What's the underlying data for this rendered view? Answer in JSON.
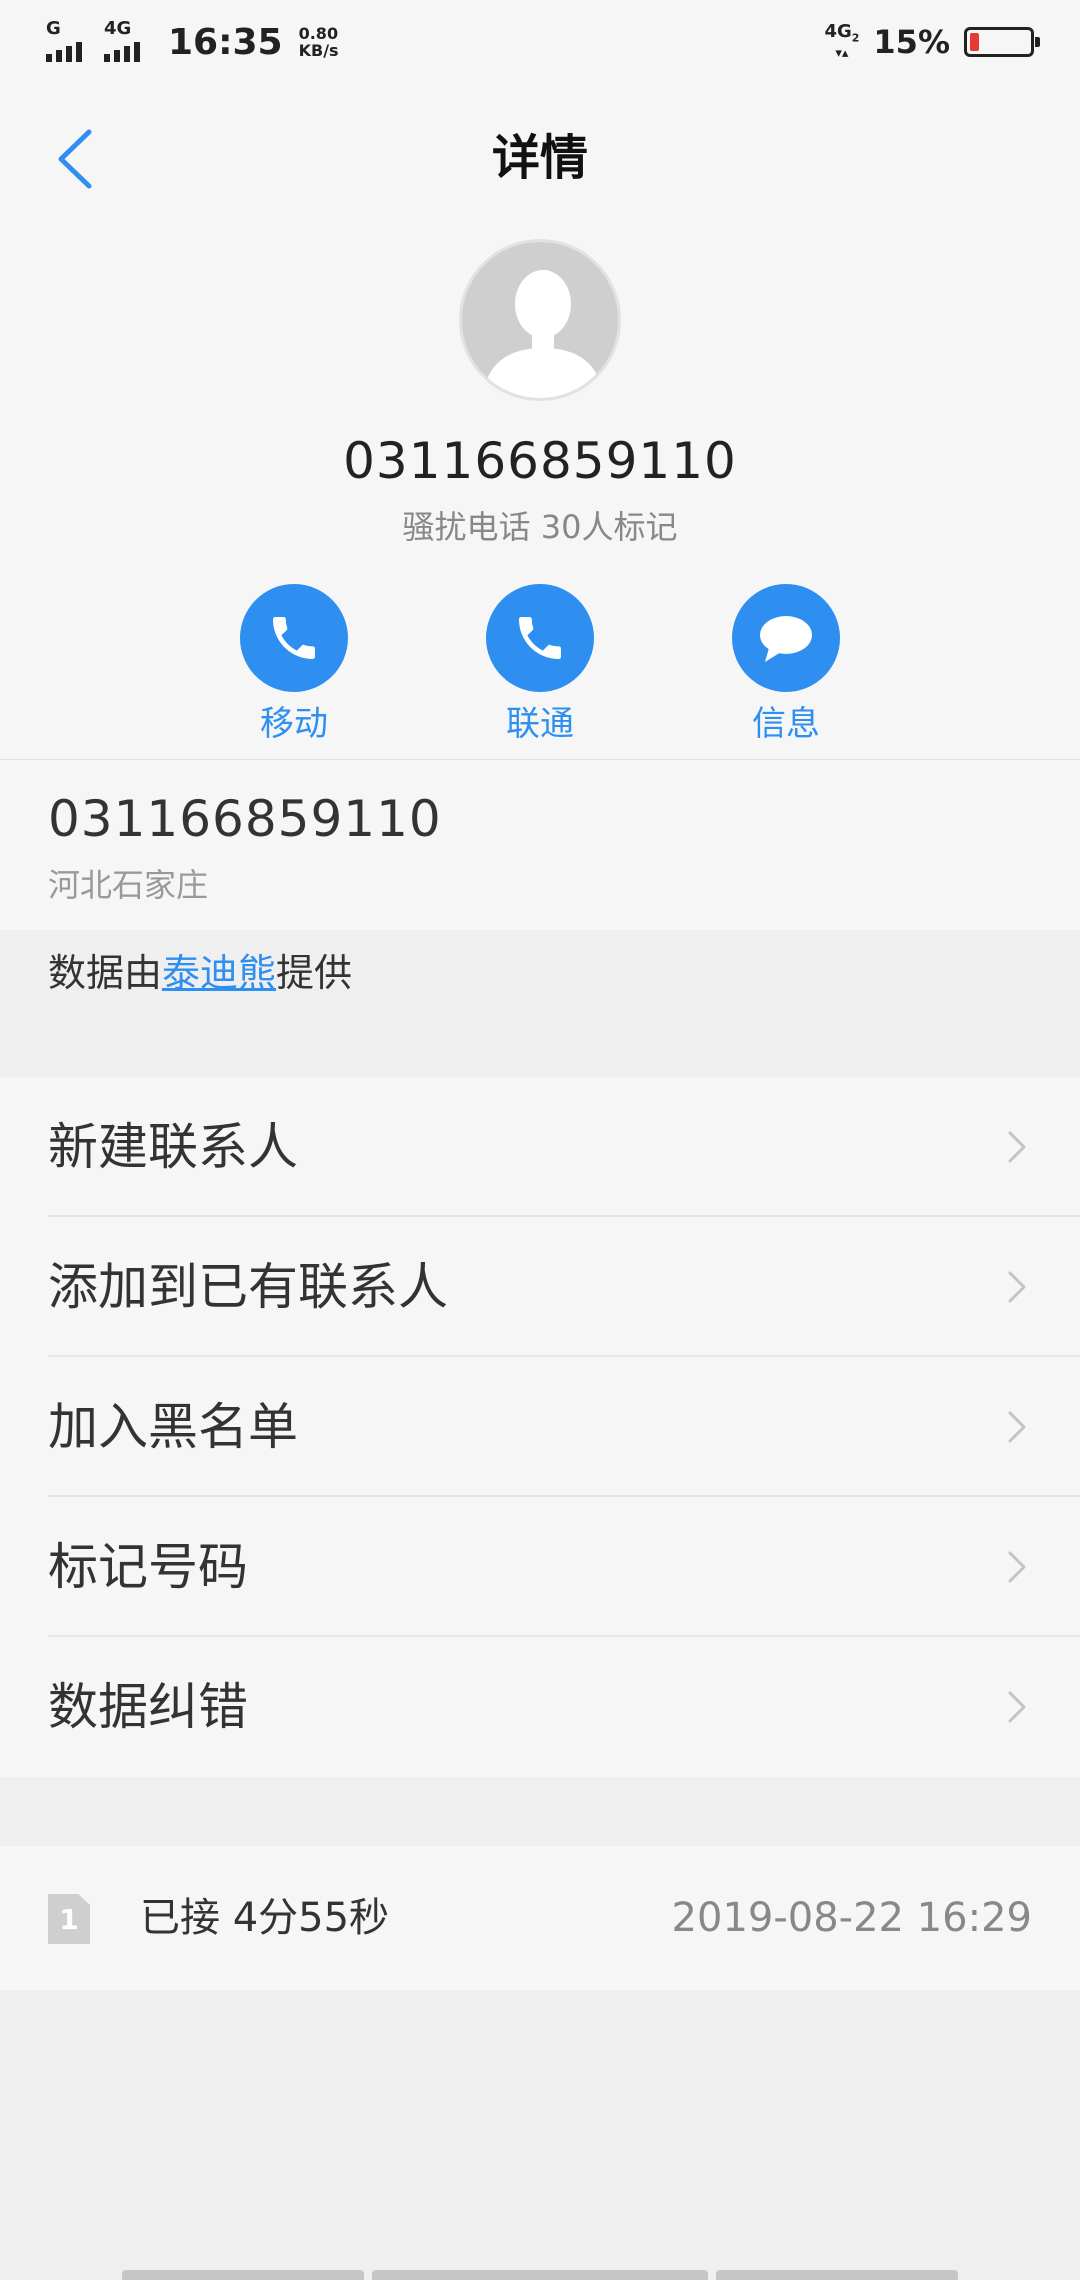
{
  "status_bar": {
    "sim1_label": "G",
    "sim2_label": "4G",
    "time": "16:35",
    "speed_value": "0.80",
    "speed_unit": "KB/s",
    "network_label": "4G",
    "network_sub": "2",
    "battery_percent": "15%",
    "battery_level": 0.15
  },
  "header": {
    "title": "详情",
    "back_icon": "chevron-left-icon"
  },
  "contact": {
    "number": "031166859110",
    "tag": "骚扰电话 30人标记"
  },
  "actions": [
    {
      "label": "移动",
      "icon": "phone-icon"
    },
    {
      "label": "联通",
      "icon": "phone-icon"
    },
    {
      "label": "信息",
      "icon": "message-icon"
    }
  ],
  "info": {
    "number": "031166859110",
    "location": "河北石家庄"
  },
  "provider": {
    "prefix": "数据由",
    "name": "泰迪熊",
    "suffix": "提供"
  },
  "menu": [
    {
      "label": "新建联系人"
    },
    {
      "label": "添加到已有联系人"
    },
    {
      "label": "加入黑名单"
    },
    {
      "label": "标记号码"
    },
    {
      "label": "数据纠错"
    }
  ],
  "call_log": {
    "sim": "1",
    "status": "已接 4分55秒",
    "datetime": "2019-08-22 16:29"
  },
  "colors": {
    "accent": "#2f8ff0",
    "battery_low": "#e53935"
  }
}
